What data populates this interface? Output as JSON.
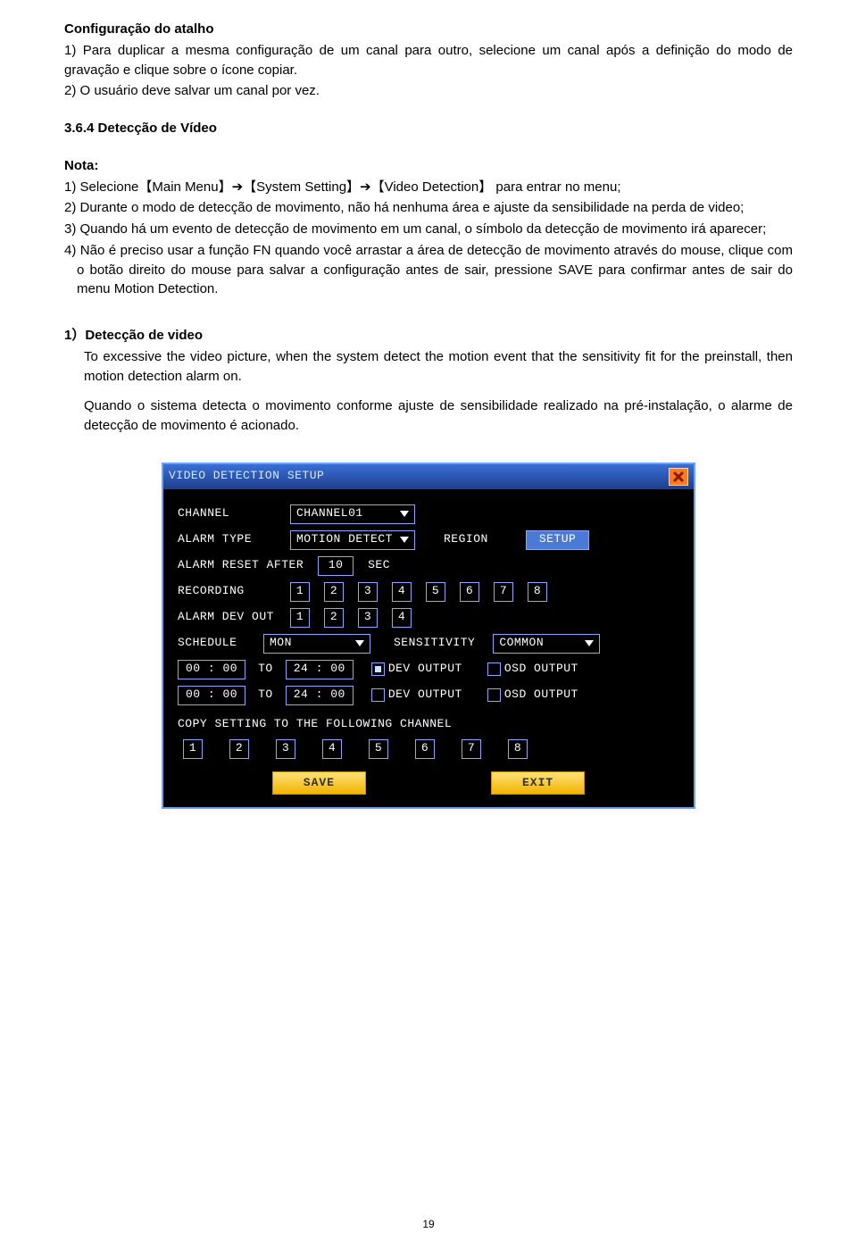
{
  "heading1": "Configuração do atalho",
  "p1a": "1) Para duplicar a mesma configuração de um canal para outro, selecione um canal após a definição do modo de gravação e clique sobre o ícone copiar.",
  "p1b": "2) O usuário deve salvar um canal por vez.",
  "heading2": "3.6.4 Detecção de Vídeo",
  "nota": "Nota:",
  "n1": "1) Selecione【Main Menu】➔【System Setting】➔【Video Detection】 para entrar no menu;",
  "n2": "2) Durante o modo de detecção de movimento, não há nenhuma área e ajuste da sensibilidade na perda de video;",
  "n3": "3) Quando há um evento de detecção de movimento em um canal, o símbolo da detecção de movimento irá aparecer;",
  "n4": "4) Não é preciso usar a função FN quando você arrastar a área de detecção de movimento através do mouse, clique com o botão direito do mouse para salvar a configuração antes de sair, pressione SAVE para confirmar antes de sair do menu Motion Detection.",
  "heading3": "1）Detecção de video",
  "p3a": "To excessive the video picture, when the system detect the motion event that the sensitivity fit for the preinstall, then motion detection alarm on.",
  "p3b": "Quando o sistema detecta o movimento conforme ajuste de sensibilidade realizado na pré-instalação, o alarme de detecção de movimento é acionado.",
  "dialog": {
    "title": "VIDEO DETECTION SETUP",
    "labels": {
      "channel": "CHANNEL",
      "alarmType": "ALARM TYPE",
      "region": "REGION",
      "alarmReset": "ALARM RESET AFTER",
      "sec": "SEC",
      "recording": "RECORDING",
      "alarmDev": "ALARM DEV OUT",
      "schedule": "SCHEDULE",
      "sensitivity": "SENSITIVITY",
      "to": "TO",
      "devOutput": "DEV OUTPUT",
      "osdOutput": "OSD OUTPUT",
      "copy": "COPY SETTING TO THE FOLLOWING CHANNEL",
      "setup": "SETUP",
      "save": "SAVE",
      "exit": "EXIT"
    },
    "values": {
      "channel": "CHANNEL01",
      "alarmType": "MOTION DETECT",
      "alarmReset": "10",
      "schedule": "MON",
      "sensitivity": "COMMON",
      "time1a": "00 : 00",
      "time1b": "24 : 00",
      "time2a": "00 : 00",
      "time2b": "24 : 00"
    },
    "numbers8": [
      "1",
      "2",
      "3",
      "4",
      "5",
      "6",
      "7",
      "8"
    ],
    "numbers4": [
      "1",
      "2",
      "3",
      "4"
    ]
  },
  "page": "19"
}
